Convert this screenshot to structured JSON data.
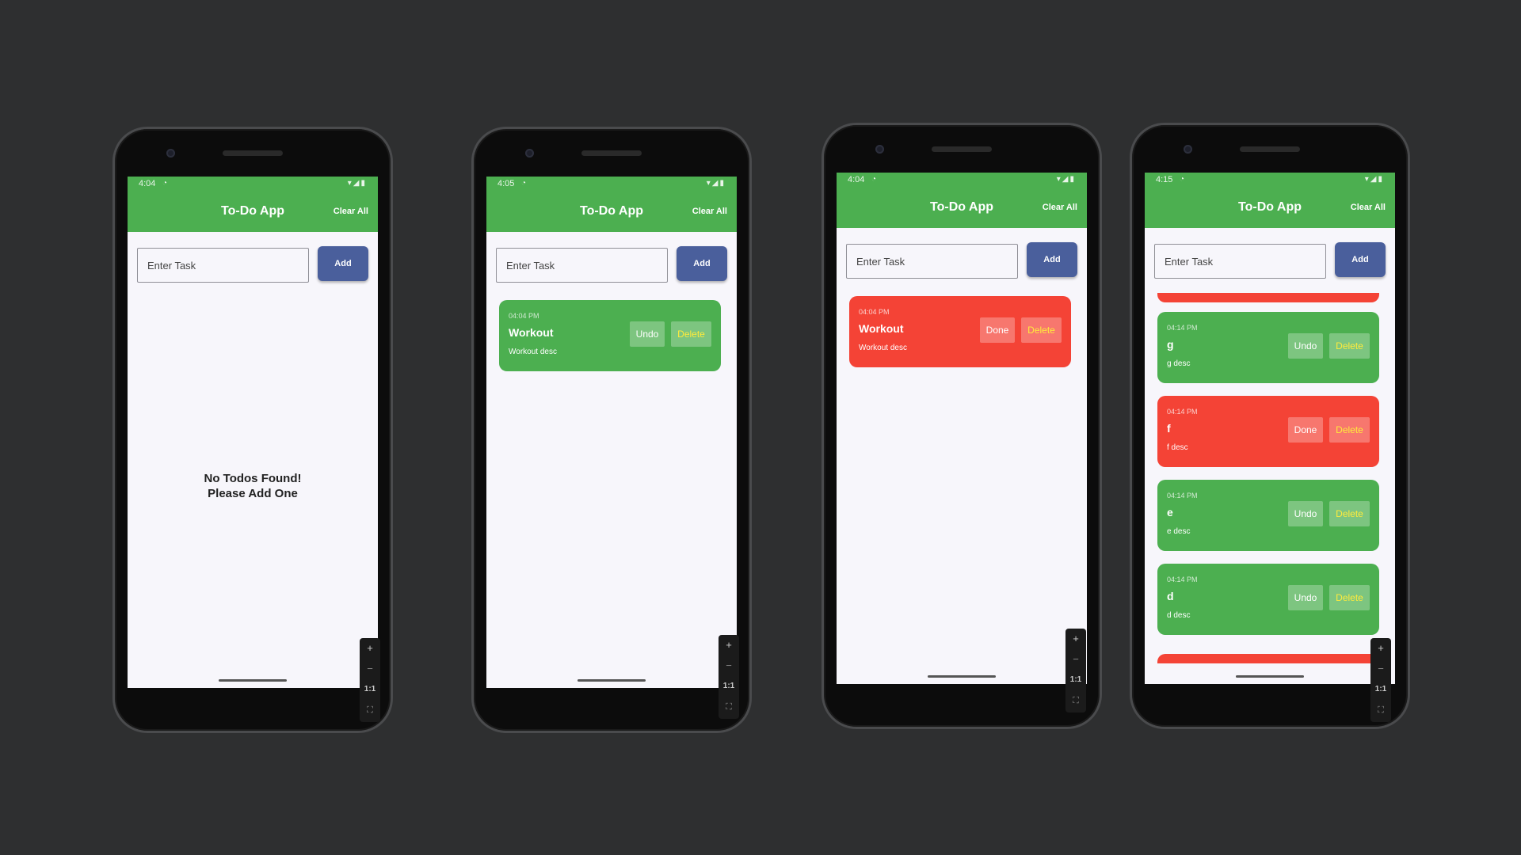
{
  "app": {
    "title": "To-Do App",
    "clear_all": "Clear All",
    "input_placeholder": "Enter Task",
    "add_label": "Add",
    "empty_message_line1": "No Todos Found!",
    "empty_message_line2": "Please Add One",
    "colors": {
      "green": "#4caf50",
      "red": "#f44336",
      "add_button": "#4a5f9c",
      "delete_text": "#ffeb3b"
    }
  },
  "zoom_controls": {
    "zoom_in": "+",
    "zoom_out": "−",
    "actual_size": "1:1",
    "fit": "⛶"
  },
  "phones": [
    {
      "time": "4:04",
      "todos": []
    },
    {
      "time": "4:05",
      "todos": [
        {
          "time": "04:04 PM",
          "title": "Workout",
          "desc": "Workout desc",
          "toggle": "Undo",
          "delete": "Delete",
          "color": "green"
        }
      ]
    },
    {
      "time": "4:04",
      "todos": [
        {
          "time": "04:04 PM",
          "title": "Workout",
          "desc": "Workout desc",
          "toggle": "Done",
          "delete": "Delete",
          "color": "red"
        }
      ]
    },
    {
      "time": "4:15",
      "todos": [
        {
          "time": "04:14 PM",
          "title": "g",
          "desc": "g desc",
          "toggle": "Undo",
          "delete": "Delete",
          "color": "green"
        },
        {
          "time": "04:14 PM",
          "title": "f",
          "desc": "f desc",
          "toggle": "Done",
          "delete": "Delete",
          "color": "red"
        },
        {
          "time": "04:14 PM",
          "title": "e",
          "desc": "e desc",
          "toggle": "Undo",
          "delete": "Delete",
          "color": "green"
        },
        {
          "time": "04:14 PM",
          "title": "d",
          "desc": "d desc",
          "toggle": "Undo",
          "delete": "Delete",
          "color": "green"
        }
      ]
    }
  ]
}
